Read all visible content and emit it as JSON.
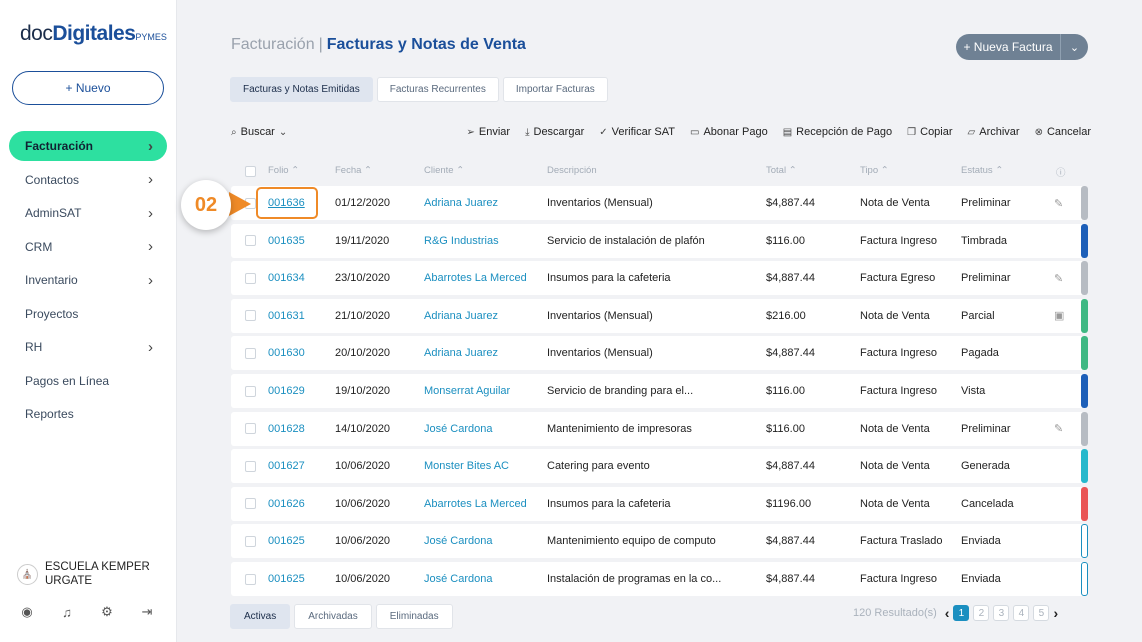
{
  "app": {
    "logo_prefix": "doc",
    "logo_brand": "Digitales",
    "logo_suffix": "PYMES",
    "new_button": "+ Nuevo"
  },
  "sidebar": {
    "items": [
      {
        "label": "Facturación",
        "chevron": true,
        "active": true
      },
      {
        "label": "Contactos",
        "chevron": true
      },
      {
        "label": "AdminSAT",
        "chevron": true
      },
      {
        "label": "CRM",
        "chevron": true
      },
      {
        "label": "Inventario",
        "chevron": true
      },
      {
        "label": "Proyectos",
        "chevron": false
      },
      {
        "label": "RH",
        "chevron": true
      },
      {
        "label": "Pagos en Línea",
        "chevron": false
      },
      {
        "label": "Reportes",
        "chevron": false
      }
    ],
    "school_line1": "ESCUELA KEMPER",
    "school_line2": "URGATE",
    "bottom_icons": [
      "user-icon",
      "bell-icon",
      "gear-icon",
      "logout-icon"
    ]
  },
  "header": {
    "parent": "Facturación",
    "separator": "|",
    "current": "Facturas y Notas de Venta",
    "new_invoice": "+ Nueva Factura",
    "dropdown_glyph": "⌄"
  },
  "tabs": [
    "Facturas y Notas Emitidas",
    "Facturas Recurrentes",
    "Importar Facturas"
  ],
  "toolbar": {
    "search": "Buscar",
    "actions": [
      {
        "icon": "send-icon",
        "glyph": "➢",
        "label": "Enviar"
      },
      {
        "icon": "download-icon",
        "glyph": "⤓",
        "label": "Descargar"
      },
      {
        "icon": "verify-icon",
        "glyph": "✓",
        "label": "Verificar SAT"
      },
      {
        "icon": "payment-icon",
        "glyph": "▭",
        "label": "Abonar Pago"
      },
      {
        "icon": "receipt-icon",
        "glyph": "▤",
        "label": "Recepción de Pago"
      },
      {
        "icon": "copy-icon",
        "glyph": "❐",
        "label": "Copiar"
      },
      {
        "icon": "folder-icon",
        "glyph": "▱",
        "label": "Archivar"
      },
      {
        "icon": "cancel-icon",
        "glyph": "⊗",
        "label": "Cancelar"
      }
    ]
  },
  "table": {
    "columns": {
      "folio": "Folio",
      "fecha": "Fecha",
      "cliente": "Cliente",
      "descripcion": "Descripción",
      "total": "Total",
      "tipo": "Tipo",
      "estatus": "Estatus"
    },
    "rows": [
      {
        "folio": "001636",
        "fecha": "01/12/2020",
        "cliente": "Adriana Juarez",
        "descripcion": "Inventarios (Mensual)",
        "total": "$4,887.44",
        "tipo": "Nota de Venta",
        "estatus": "Preliminar",
        "action": "edit",
        "bar": "#b7bcc3",
        "outline": false
      },
      {
        "folio": "001635",
        "fecha": "19/11/2020",
        "cliente": "R&G Industrias",
        "descripcion": "Servicio de instalación de plafón",
        "total": "$116.00",
        "tipo": "Factura Ingreso",
        "estatus": "Timbrada",
        "action": "",
        "bar": "#1d5fb8",
        "outline": false
      },
      {
        "folio": "001634",
        "fecha": "23/10/2020",
        "cliente": "Abarrotes La Merced",
        "descripcion": "Insumos para la cafeteria",
        "total": "$4,887.44",
        "tipo": "Factura Egreso",
        "estatus": "Preliminar",
        "action": "edit",
        "bar": "#b7bcc3",
        "outline": false
      },
      {
        "folio": "001631",
        "fecha": "21/10/2020",
        "cliente": "Adriana Juarez",
        "descripcion": "Inventarios (Mensual)",
        "total": "$216.00",
        "tipo": "Nota de Venta",
        "estatus": "Parcial",
        "action": "money",
        "bar": "#3fb883",
        "outline": false
      },
      {
        "folio": "001630",
        "fecha": "20/10/2020",
        "cliente": "Adriana Juarez",
        "descripcion": "Inventarios (Mensual)",
        "total": "$4,887.44",
        "tipo": "Factura Ingreso",
        "estatus": "Pagada",
        "action": "",
        "bar": "#3fb883",
        "outline": false
      },
      {
        "folio": "001629",
        "fecha": "19/10/2020",
        "cliente": "Monserrat Aguilar",
        "descripcion": "Servicio de branding para el...",
        "total": "$116.00",
        "tipo": "Factura Ingreso",
        "estatus": "Vista",
        "action": "",
        "bar": "#1d5fb8",
        "outline": false
      },
      {
        "folio": "001628",
        "fecha": "14/10/2020",
        "cliente": "José Cardona",
        "descripcion": "Mantenimiento de impresoras",
        "total": "$116.00",
        "tipo": "Nota de Venta",
        "estatus": "Preliminar",
        "action": "edit",
        "bar": "#b7bcc3",
        "outline": false
      },
      {
        "folio": "001627",
        "fecha": "10/06/2020",
        "cliente": "Monster Bites AC",
        "descripcion": "Catering para evento",
        "total": "$4,887.44",
        "tipo": "Nota de Venta",
        "estatus": "Generada",
        "action": "",
        "bar": "#27b8cc",
        "outline": false
      },
      {
        "folio": "001626",
        "fecha": "10/06/2020",
        "cliente": "Abarrotes La Merced",
        "descripcion": "Insumos para la cafeteria",
        "total": "$1196.00",
        "tipo": "Nota de Venta",
        "estatus": "Cancelada",
        "action": "",
        "bar": "#e95555",
        "outline": false
      },
      {
        "folio": "001625",
        "fecha": "10/06/2020",
        "cliente": "José Cardona",
        "descripcion": "Mantenimiento equipo de computo",
        "total": "$4,887.44",
        "tipo": "Factura Traslado",
        "estatus": "Enviada",
        "action": "",
        "bar": "#1b8fc0",
        "outline": true
      },
      {
        "folio": "001625",
        "fecha": "10/06/2020",
        "cliente": "José Cardona",
        "descripcion": "Instalación de programas en la co...",
        "total": "$4,887.44",
        "tipo": "Factura Ingreso",
        "estatus": "Enviada",
        "action": "",
        "bar": "#1b8fc0",
        "outline": true
      }
    ]
  },
  "callout": {
    "number": "02",
    "color": "#ef8a27"
  },
  "footer": {
    "tabs": [
      "Activas",
      "Archivadas",
      "Eliminadas"
    ],
    "results": "120 Resultado(s)",
    "pages": [
      "1",
      "2",
      "3",
      "4",
      "5"
    ],
    "current_page": "1",
    "prev": "‹",
    "next": "›"
  }
}
